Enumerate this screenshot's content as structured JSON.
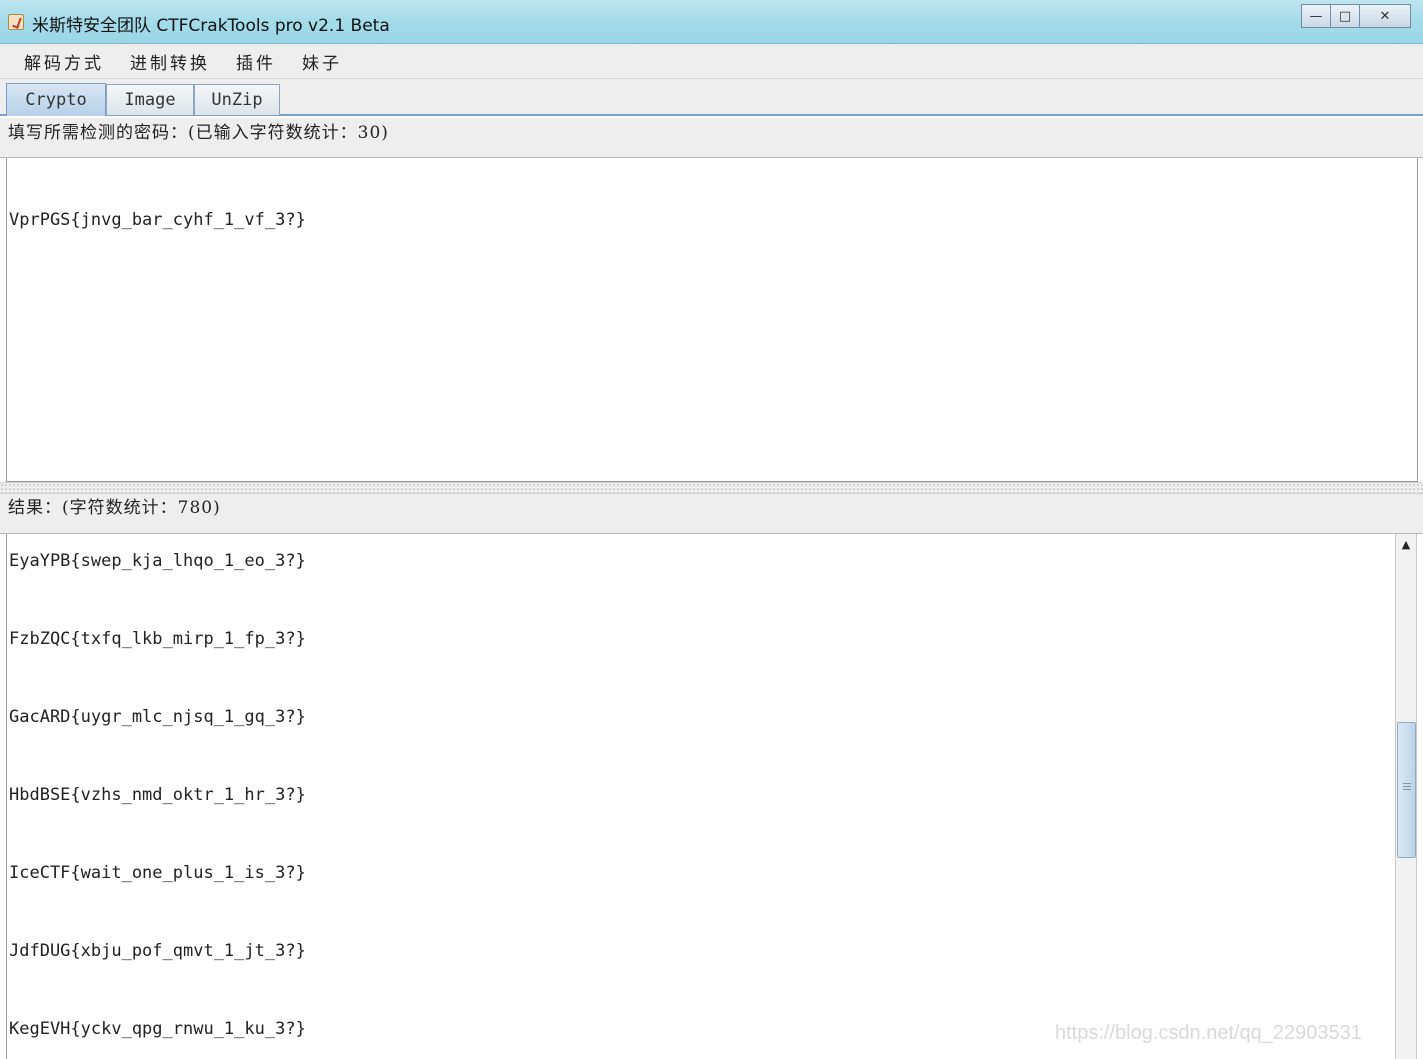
{
  "window": {
    "title": "米斯特安全团队 CTFCrakTools pro v2.1 Beta",
    "icon": "java-cup-icon",
    "controls": {
      "minimize": "—",
      "maximize": "□",
      "close": "✕"
    }
  },
  "menu": [
    "解码方式",
    "进制转换",
    "插件",
    "妹子"
  ],
  "tabs": [
    "Crypto",
    "Image",
    "UnZip"
  ],
  "input": {
    "label": "填写所需检测的密码：(已输入字符数统计：30)",
    "text": "VprPGS{jnvg_bar_cyhf_1_vf_3?}"
  },
  "result": {
    "label": "结果：(字符数统计：780)",
    "lines": [
      "EyaYPB{swep_kja_lhqo_1_eo_3?}",
      "FzbZQC{txfq_lkb_mirp_1_fp_3?}",
      "GacARD{uygr_mlc_njsq_1_gq_3?}",
      "HbdBSE{vzhs_nmd_oktr_1_hr_3?}",
      "IceCTF{wait_one_plus_1_is_3?}",
      "JdfDUG{xbju_pof_qmvt_1_jt_3?}",
      "KegEVH{yckv_qpg_rnwu_1_ku_3?}"
    ]
  },
  "scrollbar": {
    "up_arrow": "▲"
  },
  "watermark": "https://blog.csdn.net/qq_22903531"
}
